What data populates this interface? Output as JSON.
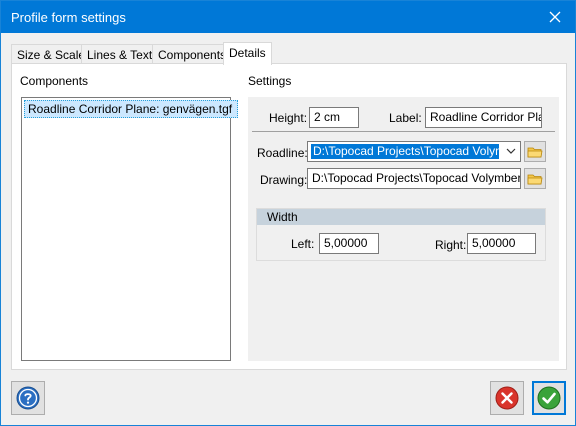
{
  "window": {
    "title": "Profile form settings"
  },
  "tabs": [
    {
      "label": "Size & Scale"
    },
    {
      "label": "Lines & Text"
    },
    {
      "label": "Components"
    },
    {
      "label": "Details"
    }
  ],
  "components": {
    "heading": "Components",
    "items": [
      {
        "label": "Roadline Corridor Plane: genvägen.tgf"
      }
    ]
  },
  "settings": {
    "heading": "Settings",
    "height_label": "Height:",
    "height_value": "2 cm",
    "label_label": "Label:",
    "label_value": "Roadline Corridor Plane",
    "roadline_label": "Roadline:",
    "roadline_value": "D:\\Topocad Projects\\Topocad Volymbe",
    "drawing_label": "Drawing:",
    "drawing_value": "D:\\Topocad Projects\\Topocad Volymberäkn",
    "width": {
      "heading": "Width",
      "left_label": "Left:",
      "left_value": "5,00000",
      "right_label": "Right:",
      "right_value": "5,00000"
    }
  },
  "icons": {
    "close": "close-icon",
    "help": "help-icon",
    "cancel": "cancel-icon",
    "ok": "checkmark-icon",
    "folder": "folder-icon",
    "dropdown": "chevron-down-icon"
  },
  "colors": {
    "titlebar": "#0078d7",
    "selection": "#0078d7",
    "list_selection": "#cce8ff",
    "cancel_red": "#d9342b",
    "ok_green": "#3aa33a"
  }
}
